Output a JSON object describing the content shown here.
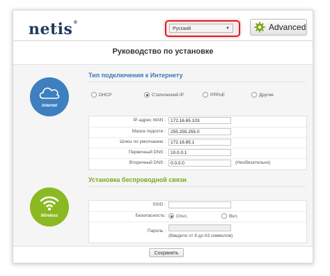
{
  "header": {
    "logo": "netis",
    "language": "Русский",
    "advanced_label": "Advanced"
  },
  "page_title": "Руководство по установке",
  "internet": {
    "icon_label": "internet",
    "title": "Тип подключения к Интернету",
    "connection_types": [
      {
        "label": "DHCP",
        "selected": false
      },
      {
        "label": "Статический IP",
        "selected": true
      },
      {
        "label": "PPPoE",
        "selected": false
      },
      {
        "label": "Другие",
        "selected": false
      }
    ],
    "fields": [
      {
        "label": "IP-адрес WAN :",
        "value": "172.16.65.103",
        "hint": ""
      },
      {
        "label": "Маска подсети :",
        "value": "255.255.255.0",
        "hint": ""
      },
      {
        "label": "Шлюз по умолчанию :",
        "value": "172.16.65.1",
        "hint": ""
      },
      {
        "label": "Первичный DNS :",
        "value": "10.0.0.1",
        "hint": ""
      },
      {
        "label": "Вторичный DNS :",
        "value": "0.0.0.0",
        "hint": "(Необязательно)"
      }
    ]
  },
  "wireless": {
    "icon_label": "Wireless",
    "title": "Установка беспроводной связи",
    "ssid_label": "SSID :",
    "ssid_value": "",
    "security_label": "Безопасность:",
    "security_options": [
      {
        "label": "Откл.",
        "selected": true
      },
      {
        "label": "Вкл.",
        "selected": false
      }
    ],
    "password_label": "Пароль :",
    "password_value": "",
    "password_hint": "(Введите от 8 до 63 символов)"
  },
  "save_label": "Сохранить",
  "colors": {
    "brand_dark": "#1f3a5f",
    "internet_blue": "#3e7fc0",
    "wireless_green": "#8bb921",
    "highlight_red": "#d61f26"
  }
}
